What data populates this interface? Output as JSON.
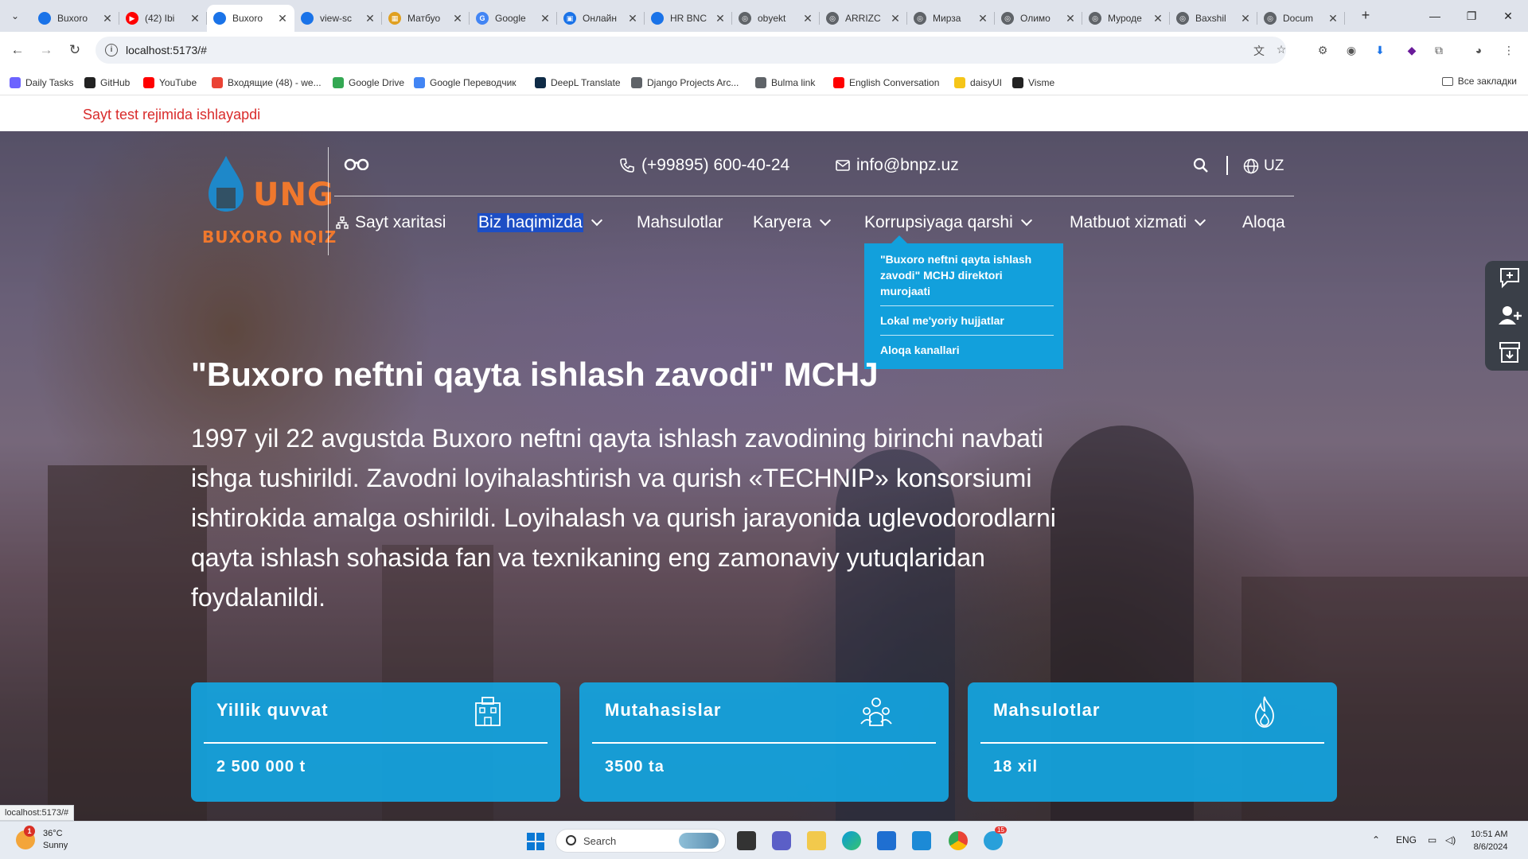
{
  "browser": {
    "tabs": [
      {
        "label": "Buxoro",
        "active": false,
        "color": "#1a73e8",
        "glyph": "💧"
      },
      {
        "label": "(42) Ibi",
        "active": false,
        "color": "#ff0000",
        "glyph": "▶"
      },
      {
        "label": "Buxoro",
        "active": true,
        "color": "#1a73e8",
        "glyph": "💧"
      },
      {
        "label": "view-sc",
        "active": false,
        "color": "#1a73e8",
        "glyph": "💧"
      },
      {
        "label": "Матбуо",
        "active": false,
        "color": "#e0a020",
        "glyph": "▦"
      },
      {
        "label": "Google",
        "active": false,
        "color": "#4285f4",
        "glyph": "G"
      },
      {
        "label": "Онлайн",
        "active": false,
        "color": "#1a73e8",
        "glyph": "▣"
      },
      {
        "label": "HR BNC",
        "active": false,
        "color": "#1a73e8",
        "glyph": "💧"
      },
      {
        "label": "obyekt",
        "active": false,
        "color": "#5f6368",
        "glyph": "◎"
      },
      {
        "label": "ARRIZC",
        "active": false,
        "color": "#5f6368",
        "glyph": "◎"
      },
      {
        "label": "Мирза",
        "active": false,
        "color": "#5f6368",
        "glyph": "◎"
      },
      {
        "label": "Олимо",
        "active": false,
        "color": "#5f6368",
        "glyph": "◎"
      },
      {
        "label": "Муроде",
        "active": false,
        "color": "#5f6368",
        "glyph": "◎"
      },
      {
        "label": "Baxshil",
        "active": false,
        "color": "#5f6368",
        "glyph": "◎"
      },
      {
        "label": "Docum",
        "active": false,
        "color": "#5f6368",
        "glyph": "◎"
      }
    ],
    "tab_close": "✕",
    "new_tab": "+",
    "url": "localhost:5173/#",
    "bookmarks": [
      {
        "label": "Daily Tasks",
        "color": "#6c63ff"
      },
      {
        "label": "GitHub",
        "color": "#222222"
      },
      {
        "label": "YouTube",
        "color": "#ff0000"
      },
      {
        "label": "Входящие (48) - we...",
        "color": "#ea4335"
      },
      {
        "label": "Google Drive",
        "color": "#34a853"
      },
      {
        "label": "Google Переводчик",
        "color": "#4285f4"
      },
      {
        "label": "DeepL Translate",
        "color": "#0f2b46"
      },
      {
        "label": "Django Projects Arc...",
        "color": "#5f6368"
      },
      {
        "label": "Bulma link",
        "color": "#5f6368"
      },
      {
        "label": "English Conversation",
        "color": "#ff0000"
      },
      {
        "label": "daisyUI",
        "color": "#f5c518"
      },
      {
        "label": "Visme",
        "color": "#222222"
      }
    ],
    "all_bookmarks": "Все закладки",
    "status_url": "localhost:5173/#"
  },
  "site": {
    "test_notice": "Sayt test rejimida ishlayapdi",
    "logo": {
      "ung": "UNG",
      "name": "BUXORO NQIZ"
    },
    "phone": "(+99895) 600-40-24",
    "email": "info@bnpz.uz",
    "lang": "UZ",
    "menu": [
      {
        "label": "Sayt xaritasi",
        "has_chevron": false
      },
      {
        "label": "Biz haqimizda",
        "has_chevron": true
      },
      {
        "label": "Mahsulotlar",
        "has_chevron": false
      },
      {
        "label": "Karyera",
        "has_chevron": true
      },
      {
        "label": "Korrupsiyaga qarshi",
        "has_chevron": true
      },
      {
        "label": "Matbuot xizmati",
        "has_chevron": true
      },
      {
        "label": "Aloqa",
        "has_chevron": false
      }
    ],
    "dropdown": [
      "\"Buxoro neftni qayta ishlash zavodi\" MCHJ direktori murojaati",
      "Lokal me'yoriy hujjatlar",
      "Aloqa kanallari"
    ],
    "hero_title": "\"Buxoro neftni qayta ishlash zavodi\" MCHJ",
    "hero_text": "1997 yil 22 avgustda Buxoro neftni qayta ishlash zavodining birinchi navbati ishga tushirildi. Zavodni loyihalashtirish va qurish «TECHNIP» konsorsiumi ishtirokida amalga oshirildi. Loyihalash va qurish jarayonida uglevodorodlarni qayta ishlash sohasida fan va texnikaning eng zamonaviy yutuqlaridan foydalanildi.",
    "stats": [
      {
        "title": "Yillik quvvat",
        "value": "2 500 000 t",
        "icon": "building-icon"
      },
      {
        "title": "Mutahasislar",
        "value": "3500 ta",
        "icon": "team-icon"
      },
      {
        "title": "Mahsulotlar",
        "value": "18 xil",
        "icon": "flame-icon"
      }
    ],
    "accent": "#12a0dc",
    "logo_color": "#f0782d"
  },
  "taskbar": {
    "weather_temp": "36°C",
    "weather_desc": "Sunny",
    "weather_badge": "1",
    "search_label": "Search",
    "lang": "ENG",
    "time": "10:51 AM",
    "date": "8/6/2024",
    "telegram_badge": "15"
  }
}
